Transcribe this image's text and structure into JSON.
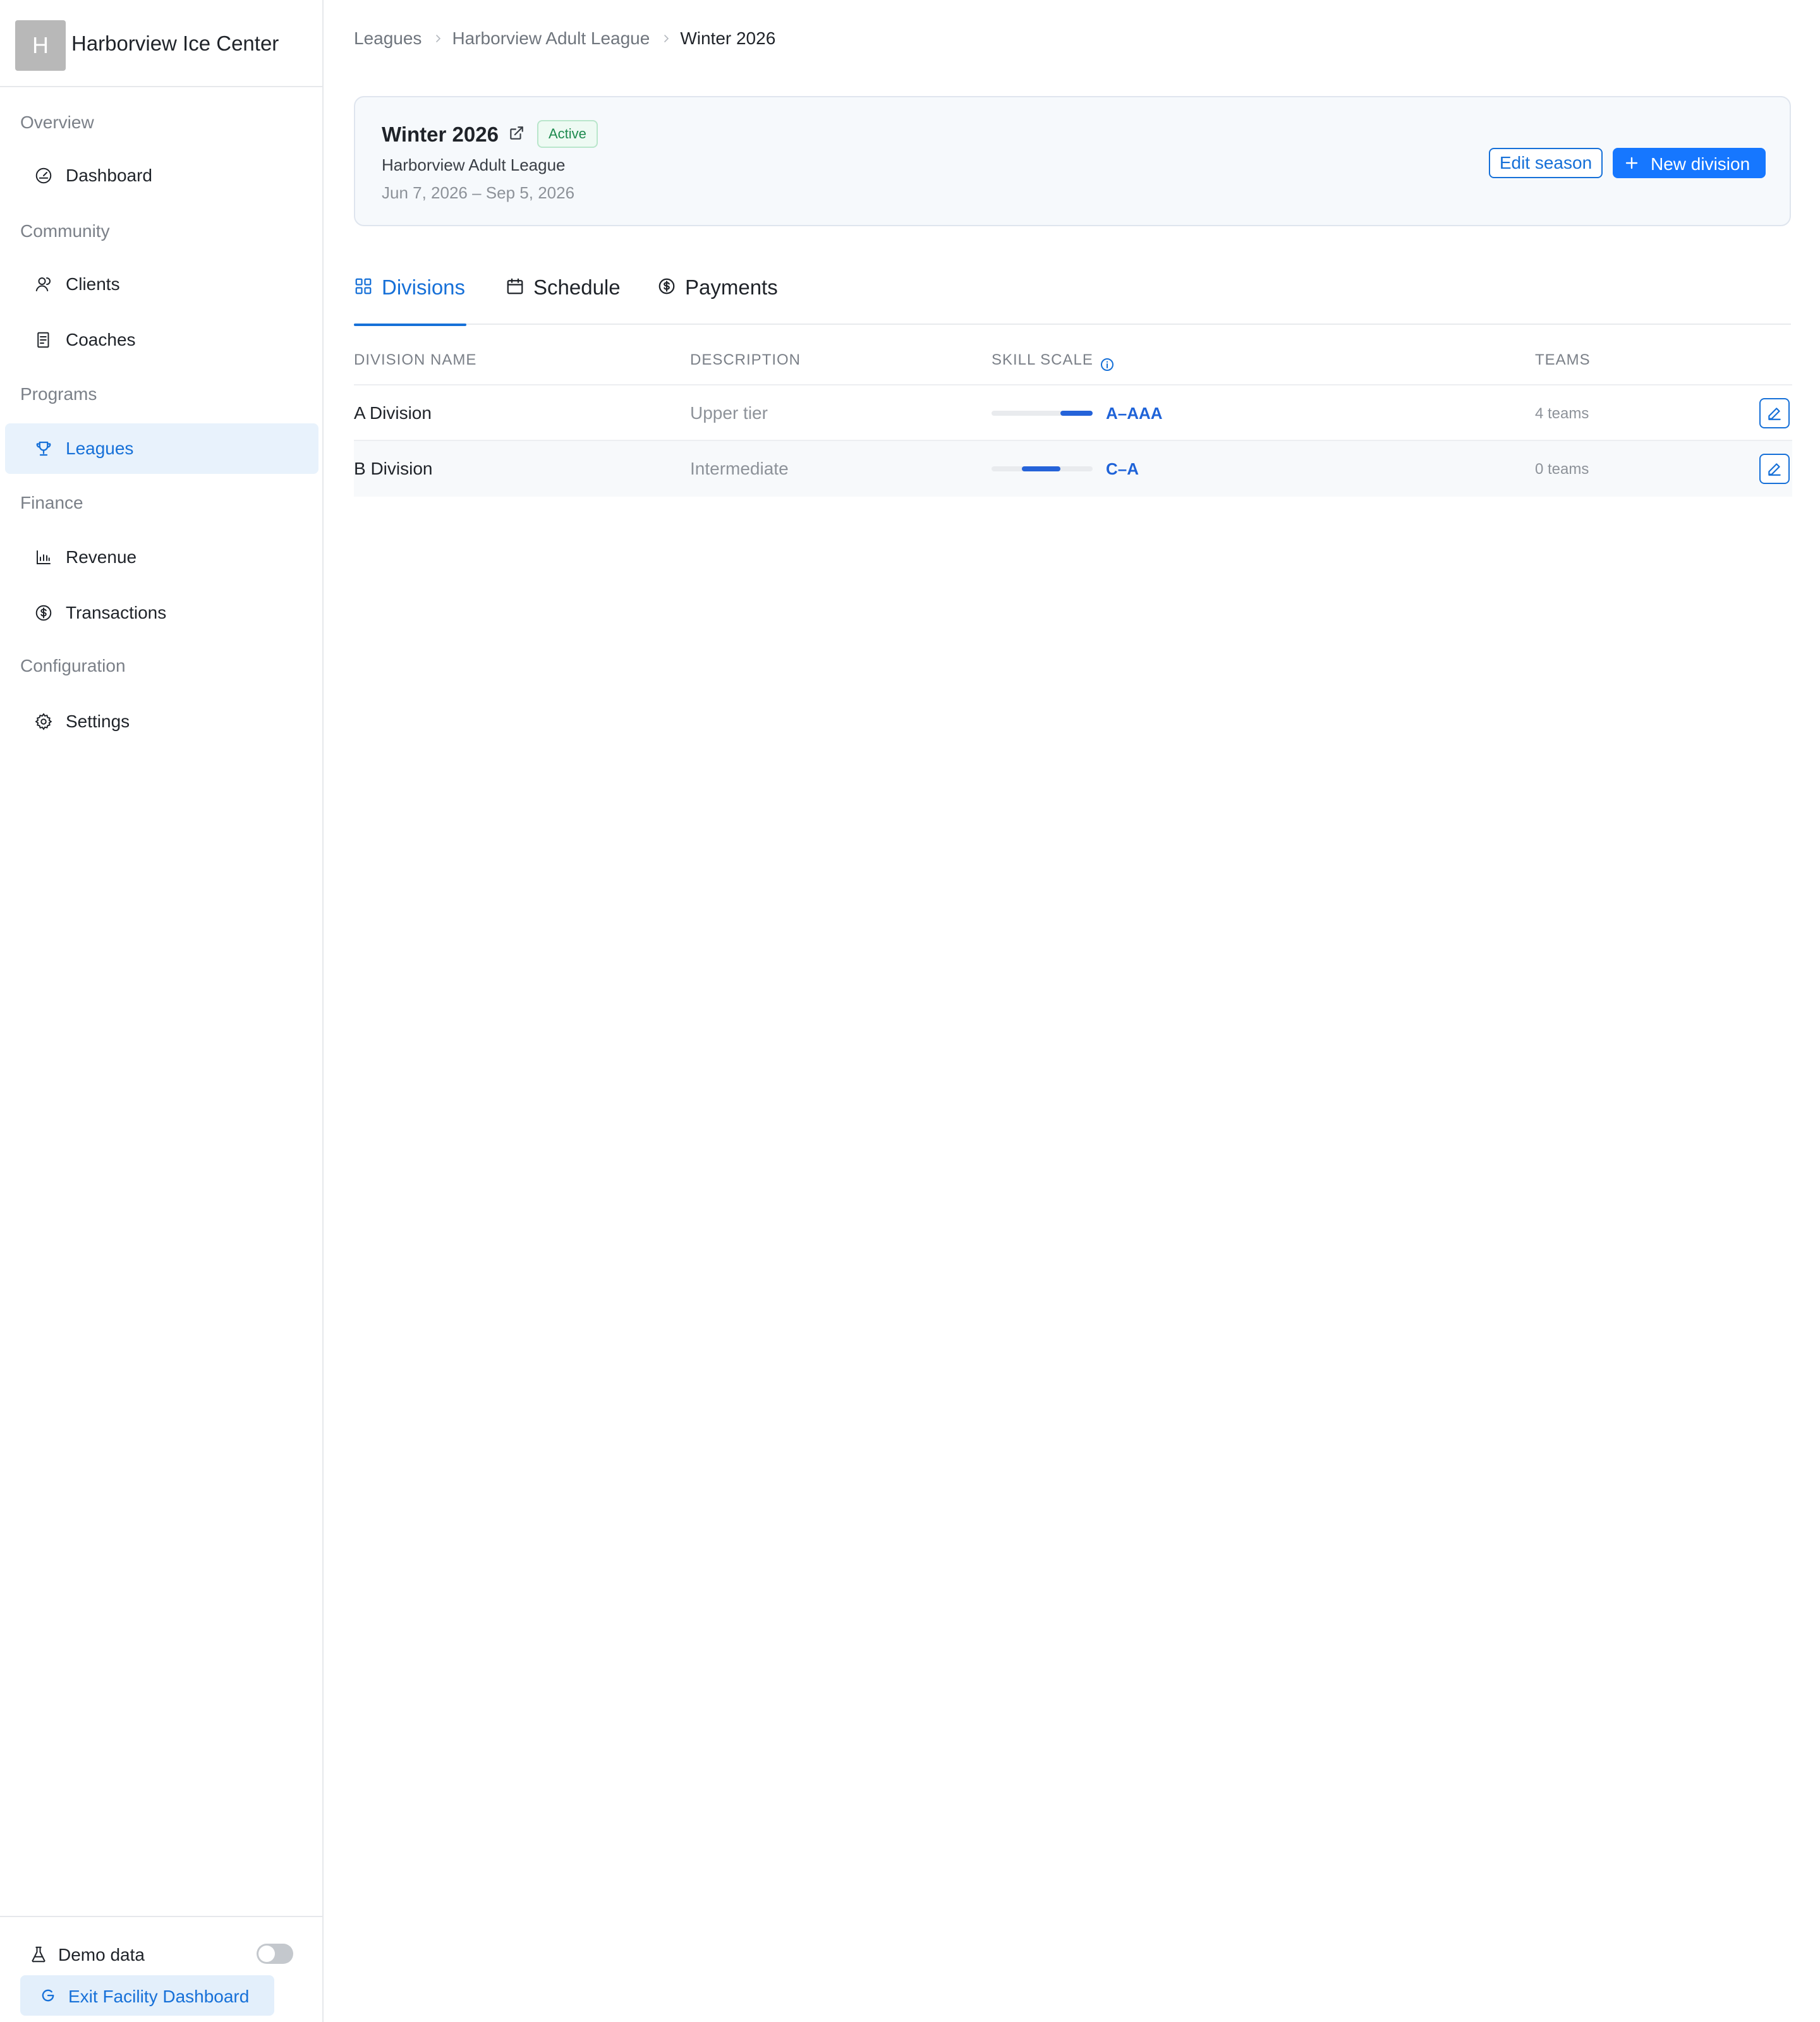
{
  "app": {
    "facility_name": "Harborview Ice Center",
    "avatar_letter": "H"
  },
  "sidebar": {
    "groups": [
      {
        "label": "Overview",
        "items": [
          {
            "label": "Dashboard",
            "icon": "gauge-icon"
          }
        ]
      },
      {
        "label": "Community",
        "items": [
          {
            "label": "Clients",
            "icon": "users-icon"
          },
          {
            "label": "Coaches",
            "icon": "clipboard-icon"
          }
        ]
      },
      {
        "label": "Programs",
        "items": [
          {
            "label": "Leagues",
            "icon": "trophy-icon",
            "active": true
          }
        ]
      },
      {
        "label": "Finance",
        "items": [
          {
            "label": "Revenue",
            "icon": "bar-chart-icon"
          },
          {
            "label": "Transactions",
            "icon": "dollar-circle-icon"
          }
        ]
      },
      {
        "label": "Configuration",
        "items": [
          {
            "label": "Settings",
            "icon": "gear-icon"
          }
        ]
      }
    ],
    "footer": {
      "demo_label": "Demo data",
      "demo_enabled": false,
      "exit_label": "Exit Facility Dashboard"
    }
  },
  "breadcrumb": [
    "Leagues",
    "Harborview Adult League",
    "Winter 2026"
  ],
  "season": {
    "title": "Winter 2026",
    "status": "Active",
    "league": "Harborview Adult League",
    "dates": "Jun 7, 2026 – Sep 5, 2026",
    "edit_label": "Edit season",
    "new_division_label": "New division"
  },
  "tabs": [
    {
      "label": "Divisions",
      "icon": "grid-icon",
      "active": true
    },
    {
      "label": "Schedule",
      "icon": "calendar-icon"
    },
    {
      "label": "Payments",
      "icon": "dollar-circle-icon"
    }
  ],
  "table": {
    "headers": {
      "name": "DIVISION NAME",
      "description": "DESCRIPTION",
      "skill": "SKILL SCALE",
      "teams": "TEAMS"
    },
    "rows": [
      {
        "name": "A Division",
        "description": "Upper tier",
        "skill_label": "A–AAA",
        "skill_range": [
          0.68,
          1.0
        ],
        "teams": "4 teams"
      },
      {
        "name": "B Division",
        "description": "Intermediate",
        "skill_label": "C–A",
        "skill_range": [
          0.3,
          0.68
        ],
        "teams": "0 teams"
      }
    ]
  },
  "colors": {
    "accent": "#1670d8",
    "primary_button": "#1677ff",
    "status_active": "#1d8a4e",
    "skill_bar": "#2563d9"
  }
}
